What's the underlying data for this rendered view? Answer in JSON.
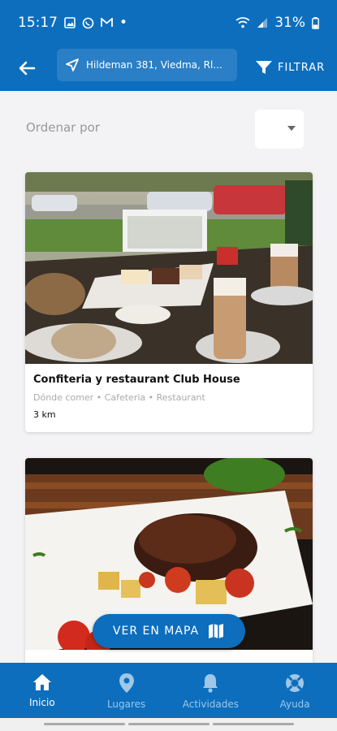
{
  "status_bar": {
    "time": "15:17",
    "battery": "31%",
    "dot": "•"
  },
  "app_bar": {
    "location": "Hildeman 381, Viedma, Rl...",
    "filter_label": "FILTRAR"
  },
  "sort": {
    "label": "Ordenar por"
  },
  "cards": [
    {
      "title": "Confiteria y restaurant Club House",
      "categories": "Dónde comer • Cafeteria • Restaurant",
      "distance": "3 km"
    }
  ],
  "map_button": {
    "label": "VER EN MAPA"
  },
  "bottom_nav": {
    "items": [
      {
        "label": "Inicio",
        "icon": "home-icon"
      },
      {
        "label": "Lugares",
        "icon": "location-pin-icon"
      },
      {
        "label": "Actividades",
        "icon": "bell-icon"
      },
      {
        "label": "Ayuda",
        "icon": "lifebuoy-icon"
      }
    ],
    "active_index": 0
  },
  "colors": {
    "primary": "#0d6ebd",
    "background": "#f3f3f6"
  }
}
